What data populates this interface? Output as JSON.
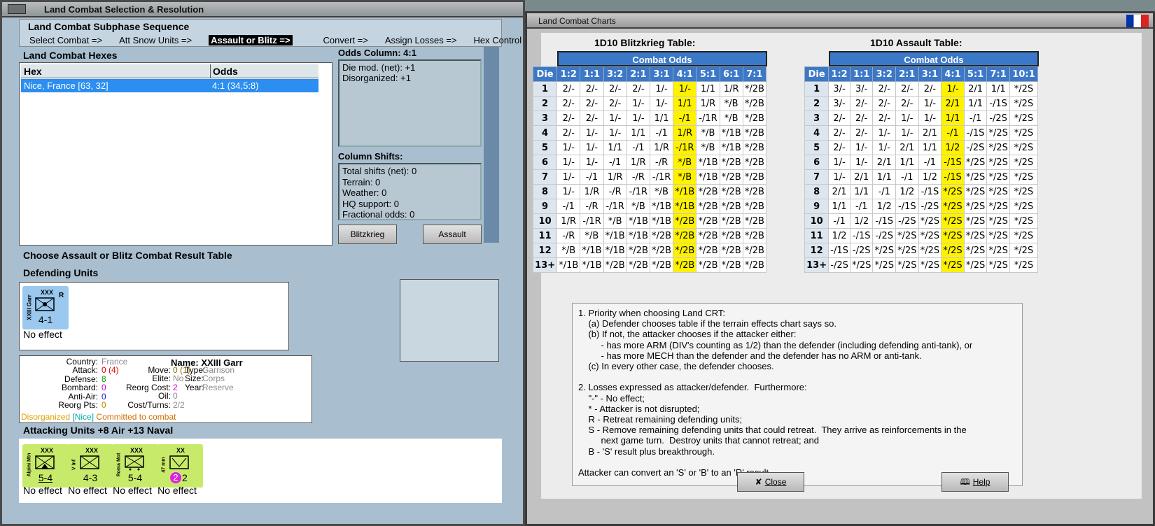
{
  "left": {
    "title": "Land Combat Selection & Resolution",
    "subphase_title": "Land Combat Subphase Sequence",
    "sequence": [
      "Select Combat =>",
      "Att Snow Units =>",
      "Assault or Blitz =>",
      "Convert =>",
      "Assign Losses =>",
      "Hex Control"
    ],
    "hexes_title": "Land Combat Hexes",
    "col_hex": "Hex",
    "col_odds": "Odds",
    "row_hex": "Nice, France [63, 32]",
    "row_odds": "4:1 (34,5:8)",
    "odds_col_title": "Odds Column: 4:1",
    "odds_lines": [
      "Die mod. (net): +1",
      "Disorganized: +1"
    ],
    "shifts_title": "Column Shifts:",
    "shifts": [
      "Total shifts (net): 0",
      "Terrain: 0",
      "Weather: 0",
      "HQ support: 0",
      "Fractional odds: 0"
    ],
    "blitz_btn": "Blitzkrieg",
    "assault_btn": "Assault",
    "choose": "Choose Assault or Blitz Combat Result Table",
    "defending_title": "Defending Units",
    "def_unit": {
      "side": "XXIII Garr",
      "top": "XXX",
      "mark": "R",
      "val": "4-1",
      "effect": "No effect"
    },
    "info": {
      "country_l": "Country:",
      "country": "France",
      "attack_l": "Attack:",
      "attack": "0 (4)",
      "defense_l": "Defense:",
      "defense": "8",
      "bombard_l": "Bombard:",
      "bombard": "0",
      "antiair_l": "Anti-Air:",
      "antiair": "0",
      "reorg_l": "Reorg Pts:",
      "reorg": "0",
      "move_l": "Move:",
      "move": "0 (1)",
      "elite_l": "Elite:",
      "elite": "No",
      "rcost_l": "Reorg Cost:",
      "rcost": "2",
      "oil_l": "Oil:",
      "oil": "0",
      "ct_l": "Cost/Turns:",
      "ct": "2/2",
      "name_l": "Name:",
      "name": "XXIII Garr",
      "type_l": "Type:",
      "type": "Garrison",
      "size_l": "Size:",
      "size": "Corps",
      "year_l": "Year:",
      "year": "Reserve",
      "st1": "Disorganized",
      "st2": "[Nice]",
      "st3": "Committed to combat"
    },
    "attacking_title": "Attacking Units +8 Air +13 Naval",
    "att_units": [
      {
        "side": "Alpini Mtn",
        "top": "XXX",
        "val": "5-4",
        "effect": "No effect"
      },
      {
        "side": "V Inf",
        "top": "XXX",
        "val": "4-3",
        "effect": "No effect"
      },
      {
        "side": "Roma Mot",
        "top": "XXX",
        "val": "5-4",
        "effect": "No effect"
      },
      {
        "side": "47 mm",
        "top": "XX",
        "val": "2",
        "badge": "2",
        "effect": "No effect"
      }
    ]
  },
  "right": {
    "title": "Land Combat Charts",
    "blitz_title": "1D10 Blitzkrieg Table:",
    "assault_title": "1D10 Assault Table:",
    "combat_odds": "Combat Odds",
    "die": "Die",
    "blitz_cols": [
      "1:2",
      "1:1",
      "3:2",
      "2:1",
      "3:1",
      "4:1",
      "5:1",
      "6:1",
      "7:1"
    ],
    "assault_cols": [
      "1:2",
      "1:1",
      "3:2",
      "2:1",
      "3:1",
      "4:1",
      "5:1",
      "7:1",
      "10:1"
    ],
    "dice": [
      "1",
      "2",
      "3",
      "4",
      "5",
      "6",
      "7",
      "8",
      "9",
      "10",
      "11",
      "12",
      "13+"
    ],
    "blitz": [
      [
        "2/-",
        "2/-",
        "2/-",
        "2/-",
        "1/-",
        "1/-",
        "1/1",
        "1/R",
        "*/2B"
      ],
      [
        "2/-",
        "2/-",
        "2/-",
        "1/-",
        "1/-",
        "1/1",
        "1/R",
        "*/B",
        "*/2B"
      ],
      [
        "2/-",
        "2/-",
        "1/-",
        "1/-",
        "1/1",
        "-/1",
        "-/1R",
        "*/B",
        "*/2B"
      ],
      [
        "2/-",
        "1/-",
        "1/-",
        "1/1",
        "-/1",
        "1/R",
        "*/B",
        "*/1B",
        "*/2B"
      ],
      [
        "1/-",
        "1/-",
        "1/1",
        "-/1",
        "1/R",
        "-/1R",
        "*/B",
        "*/1B",
        "*/2B"
      ],
      [
        "1/-",
        "1/-",
        "-/1",
        "1/R",
        "-/R",
        "*/B",
        "*/1B",
        "*/2B",
        "*/2B"
      ],
      [
        "1/-",
        "-/1",
        "1/R",
        "-/R",
        "-/1R",
        "*/B",
        "*/1B",
        "*/2B",
        "*/2B"
      ],
      [
        "1/-",
        "1/R",
        "-/R",
        "-/1R",
        "*/B",
        "*/1B",
        "*/2B",
        "*/2B",
        "*/2B"
      ],
      [
        "-/1",
        "-/R",
        "-/1R",
        "*/B",
        "*/1B",
        "*/1B",
        "*/2B",
        "*/2B",
        "*/2B"
      ],
      [
        "1/R",
        "-/1R",
        "*/B",
        "*/1B",
        "*/1B",
        "*/2B",
        "*/2B",
        "*/2B",
        "*/2B"
      ],
      [
        "-/R",
        "*/B",
        "*/1B",
        "*/1B",
        "*/2B",
        "*/2B",
        "*/2B",
        "*/2B",
        "*/2B"
      ],
      [
        "*/B",
        "*/1B",
        "*/1B",
        "*/2B",
        "*/2B",
        "*/2B",
        "*/2B",
        "*/2B",
        "*/2B"
      ],
      [
        "*/1B",
        "*/1B",
        "*/2B",
        "*/2B",
        "*/2B",
        "*/2B",
        "*/2B",
        "*/2B",
        "*/2B"
      ]
    ],
    "assault": [
      [
        "3/-",
        "3/-",
        "2/-",
        "2/-",
        "2/-",
        "1/-",
        "2/1",
        "1/1",
        "*/2S"
      ],
      [
        "3/-",
        "2/-",
        "2/-",
        "2/-",
        "1/-",
        "2/1",
        "1/1",
        "-/1S",
        "*/2S"
      ],
      [
        "2/-",
        "2/-",
        "2/-",
        "1/-",
        "1/-",
        "1/1",
        "-/1",
        "-/2S",
        "*/2S"
      ],
      [
        "2/-",
        "2/-",
        "1/-",
        "1/-",
        "2/1",
        "-/1",
        "-/1S",
        "*/2S",
        "*/2S"
      ],
      [
        "2/-",
        "1/-",
        "1/-",
        "2/1",
        "1/1",
        "1/2",
        "-/2S",
        "*/2S",
        "*/2S"
      ],
      [
        "1/-",
        "1/-",
        "2/1",
        "1/1",
        "-/1",
        "-/1S",
        "*/2S",
        "*/2S",
        "*/2S"
      ],
      [
        "1/-",
        "2/1",
        "1/1",
        "-/1",
        "1/2",
        "-/1S",
        "*/2S",
        "*/2S",
        "*/2S"
      ],
      [
        "2/1",
        "1/1",
        "-/1",
        "1/2",
        "-/1S",
        "*/2S",
        "*/2S",
        "*/2S",
        "*/2S"
      ],
      [
        "1/1",
        "-/1",
        "1/2",
        "-/1S",
        "-/2S",
        "*/2S",
        "*/2S",
        "*/2S",
        "*/2S"
      ],
      [
        "-/1",
        "1/2",
        "-/1S",
        "-/2S",
        "*/2S",
        "*/2S",
        "*/2S",
        "*/2S",
        "*/2S"
      ],
      [
        "1/2",
        "-/1S",
        "-/2S",
        "*/2S",
        "*/2S",
        "*/2S",
        "*/2S",
        "*/2S",
        "*/2S"
      ],
      [
        "-/1S",
        "-/2S",
        "*/2S",
        "*/2S",
        "*/2S",
        "*/2S",
        "*/2S",
        "*/2S",
        "*/2S"
      ],
      [
        "-/2S",
        "*/2S",
        "*/2S",
        "*/2S",
        "*/2S",
        "*/2S",
        "*/2S",
        "*/2S",
        "*/2S"
      ]
    ],
    "highlight_col": 5,
    "notes": "1. Priority when choosing Land CRT:\n    (a) Defender chooses table if the terrain effects chart says so.\n    (b) If not, the attacker chooses if the attacker either:\n         - has more ARM (DIV's counting as 1/2) than the defender (including defending anti-tank), or\n         - has more MECH than the defender and the defender has no ARM or anti-tank.\n    (c) In every other case, the defender chooses.\n\n2. Losses expressed as attacker/defender.  Furthermore:\n    \"-\" - No effect;\n    * - Attacker is not disrupted;\n    R - Retreat remaining defending units;\n    S - Remove remaining defending units that could retreat.  They arrive as reinforcements in the\n         next game turn.  Destroy units that cannot retreat; and\n    B - 'S' result plus breakthrough.\n\nAttacker can convert an 'S' or 'B' to an 'R' result.",
    "close_btn": "Close",
    "help_btn": "Help"
  },
  "colors": {
    "accent": "#3c78c8",
    "highlight": "#fff200",
    "counter_def": "#9ac8ee",
    "counter_att": "#c8ea6a"
  }
}
